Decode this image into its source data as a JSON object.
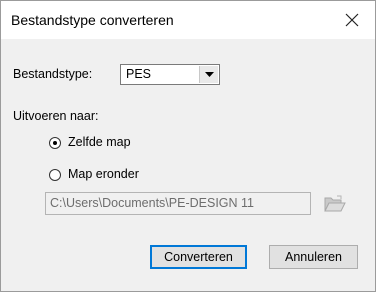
{
  "dialog": {
    "title": "Bestandstype converteren"
  },
  "file_type": {
    "label": "Bestandstype:",
    "value": "PES"
  },
  "output": {
    "label": "Uitvoeren naar:",
    "option_same": "Zelfde map",
    "option_below": "Map eronder",
    "selected": "Zelfde map",
    "path": "C:\\Users\\Documents\\PE-DESIGN 11"
  },
  "buttons": {
    "convert": "Converteren",
    "cancel": "Annuleren"
  },
  "icons": {
    "close": "close-icon",
    "dropdown": "chevron-down-icon",
    "browse": "folder-open-icon"
  }
}
